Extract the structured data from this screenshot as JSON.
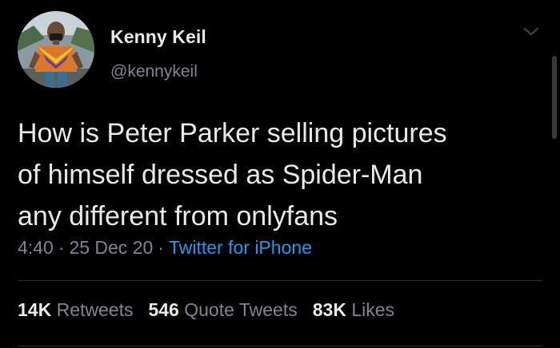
{
  "author": {
    "name": "Kenny Keil",
    "handle": "@kennykeil"
  },
  "icons": {
    "avatar": "profile-photo",
    "menu": "chevron-down-icon"
  },
  "tweet": {
    "text_lines": [
      "How is Peter Parker selling pictures",
      "of himself dressed as Spider-Man",
      "any different from onlyfans"
    ],
    "time": "4:40",
    "date": "25 Dec 20",
    "separator": "·",
    "source": "Twitter for iPhone"
  },
  "stats": [
    {
      "count": "14K",
      "label": "Retweets"
    },
    {
      "count": "546",
      "label": "Quote Tweets"
    },
    {
      "count": "83K",
      "label": "Likes"
    }
  ],
  "colors": {
    "background": "#000000",
    "text_primary": "#e7e9ea",
    "text_secondary": "#7c8791",
    "link": "#1d9bf0",
    "divider": "#2a2f33"
  }
}
